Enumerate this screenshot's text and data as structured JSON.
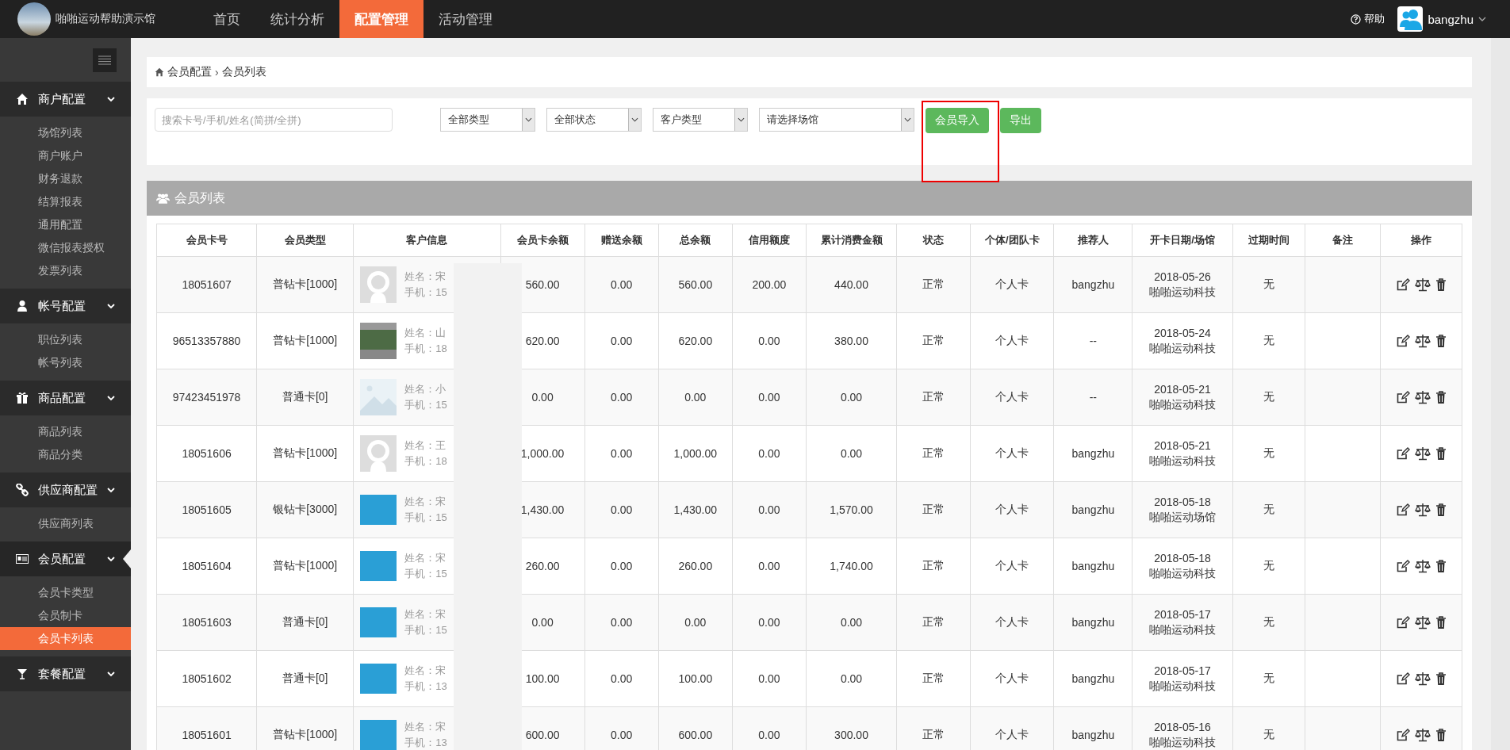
{
  "header": {
    "brand": "啪啪运动帮助演示馆",
    "nav": [
      {
        "label": "首页",
        "selected": false
      },
      {
        "label": "统计分析",
        "selected": false
      },
      {
        "label": "配置管理",
        "selected": true
      },
      {
        "label": "活动管理",
        "selected": false
      }
    ],
    "help": "帮助",
    "user": "bangzhu"
  },
  "sidebar": {
    "groups": [
      {
        "label": "商户配置",
        "expanded": true,
        "active": false,
        "items": [
          {
            "label": "场馆列表",
            "selected": false
          },
          {
            "label": "商户账户",
            "selected": false
          },
          {
            "label": "财务退款",
            "selected": false
          },
          {
            "label": "结算报表",
            "selected": false
          },
          {
            "label": "通用配置",
            "selected": false
          },
          {
            "label": "微信报表授权",
            "selected": false
          },
          {
            "label": "发票列表",
            "selected": false
          }
        ]
      },
      {
        "label": "帐号配置",
        "expanded": true,
        "active": false,
        "items": [
          {
            "label": "职位列表",
            "selected": false
          },
          {
            "label": "帐号列表",
            "selected": false
          }
        ]
      },
      {
        "label": "商品配置",
        "expanded": true,
        "active": false,
        "items": [
          {
            "label": "商品列表",
            "selected": false
          },
          {
            "label": "商品分类",
            "selected": false
          }
        ]
      },
      {
        "label": "供应商配置",
        "expanded": true,
        "active": false,
        "items": [
          {
            "label": "供应商列表",
            "selected": false
          }
        ]
      },
      {
        "label": "会员配置",
        "expanded": true,
        "active": true,
        "items": [
          {
            "label": "会员卡类型",
            "selected": false
          },
          {
            "label": "会员制卡",
            "selected": false
          },
          {
            "label": "会员卡列表",
            "selected": true
          }
        ]
      },
      {
        "label": "套餐配置",
        "expanded": true,
        "active": false
      }
    ]
  },
  "breadcrumb": {
    "items": [
      "会员配置",
      "会员列表"
    ],
    "separator": "›"
  },
  "filters": {
    "search": {
      "placeholder": "搜索卡号/手机/姓名(简拼/全拼)"
    },
    "selects": [
      "全部类型",
      "全部状态",
      "客户类型",
      "请选择场馆"
    ],
    "buttons": [
      {
        "label": "会员导入",
        "highlighted": true
      },
      {
        "label": "导出",
        "highlighted": false
      }
    ]
  },
  "panel_title": "会员列表",
  "table": {
    "columns": [
      "会员卡号",
      "会员类型",
      "客户信息",
      "会员卡余额",
      "赠送余额",
      "总余额",
      "信用额度",
      "累计消费金额",
      "状态",
      "个体/团队卡",
      "推荐人",
      "开卡日期/场馆",
      "过期时间",
      "备注",
      "操作"
    ],
    "rows": [
      {
        "card_no": "18051607",
        "type": "普钻卡[1000]",
        "avatar": {
          "kind": "unknown"
        },
        "name": "姓名：宋",
        "phone": "手机：15",
        "card_balance": "560.00",
        "gift_balance": "0.00",
        "total": "560.00",
        "credit": "200.00",
        "spent": "440.00",
        "status": "正常",
        "card_kind": "个人卡",
        "referrer": "bangzhu",
        "date": "2018-05-26",
        "venue": "啪啪运动科技",
        "expiry": "无"
      },
      {
        "card_no": "96513357880",
        "type": "普钻卡[1000]",
        "avatar": {
          "kind": "photo"
        },
        "name": "姓名：山",
        "phone": "手机：18",
        "card_balance": "620.00",
        "gift_balance": "0.00",
        "total": "620.00",
        "credit": "0.00",
        "spent": "380.00",
        "status": "正常",
        "card_kind": "个人卡",
        "referrer": "--",
        "date": "2018-05-24",
        "venue": "啪啪运动科技",
        "expiry": "无"
      },
      {
        "card_no": "97423451978",
        "type": "普通卡[0]",
        "avatar": {
          "kind": "placeholder"
        },
        "name": "姓名：小",
        "phone": "手机：15",
        "card_balance": "0.00",
        "gift_balance": "0.00",
        "total": "0.00",
        "credit": "0.00",
        "spent": "0.00",
        "status": "正常",
        "card_kind": "个人卡",
        "referrer": "--",
        "date": "2018-05-21",
        "venue": "啪啪运动科技",
        "expiry": "无"
      },
      {
        "card_no": "18051606",
        "type": "普钻卡[1000]",
        "avatar": {
          "kind": "unknown"
        },
        "name": "姓名：王",
        "phone": "手机：18",
        "card_balance": "1,000.00",
        "gift_balance": "0.00",
        "total": "1,000.00",
        "credit": "0.00",
        "spent": "0.00",
        "status": "正常",
        "card_kind": "个人卡",
        "referrer": "bangzhu",
        "date": "2018-05-21",
        "venue": "啪啪运动科技",
        "expiry": "无"
      },
      {
        "card_no": "18051605",
        "type": "银钻卡[3000]",
        "avatar": {
          "kind": "photo-blue"
        },
        "name": "姓名：宋",
        "phone": "手机：15",
        "card_balance": "1,430.00",
        "gift_balance": "0.00",
        "total": "1,430.00",
        "credit": "0.00",
        "spent": "1,570.00",
        "status": "正常",
        "card_kind": "个人卡",
        "referrer": "bangzhu",
        "date": "2018-05-18",
        "venue": "啪啪运动场馆",
        "expiry": "无"
      },
      {
        "card_no": "18051604",
        "type": "普钻卡[1000]",
        "avatar": {
          "kind": "photo-blue"
        },
        "name": "姓名：宋",
        "phone": "手机：15",
        "card_balance": "260.00",
        "gift_balance": "0.00",
        "total": "260.00",
        "credit": "0.00",
        "spent": "1,740.00",
        "status": "正常",
        "card_kind": "个人卡",
        "referrer": "bangzhu",
        "date": "2018-05-18",
        "venue": "啪啪运动科技",
        "expiry": "无"
      },
      {
        "card_no": "18051603",
        "type": "普通卡[0]",
        "avatar": {
          "kind": "photo-blue"
        },
        "name": "姓名：宋",
        "phone": "手机：15",
        "card_balance": "0.00",
        "gift_balance": "0.00",
        "total": "0.00",
        "credit": "0.00",
        "spent": "0.00",
        "status": "正常",
        "card_kind": "个人卡",
        "referrer": "bangzhu",
        "date": "2018-05-17",
        "venue": "啪啪运动科技",
        "expiry": "无"
      },
      {
        "card_no": "18051602",
        "type": "普通卡[0]",
        "avatar": {
          "kind": "photo-blue"
        },
        "name": "姓名：宋",
        "phone": "手机：13",
        "card_balance": "100.00",
        "gift_balance": "0.00",
        "total": "100.00",
        "credit": "0.00",
        "spent": "0.00",
        "status": "正常",
        "card_kind": "个人卡",
        "referrer": "bangzhu",
        "date": "2018-05-17",
        "venue": "啪啪运动科技",
        "expiry": "无"
      },
      {
        "card_no": "18051601",
        "type": "普钻卡[1000]",
        "avatar": {
          "kind": "photo-blue"
        },
        "name": "姓名：宋",
        "phone": "手机：13",
        "card_balance": "600.00",
        "gift_balance": "0.00",
        "total": "600.00",
        "credit": "0.00",
        "spent": "300.00",
        "status": "正常",
        "card_kind": "个人卡",
        "referrer": "bangzhu",
        "date": "2018-05-16",
        "venue": "啪啪运动科技",
        "expiry": "无"
      }
    ]
  }
}
